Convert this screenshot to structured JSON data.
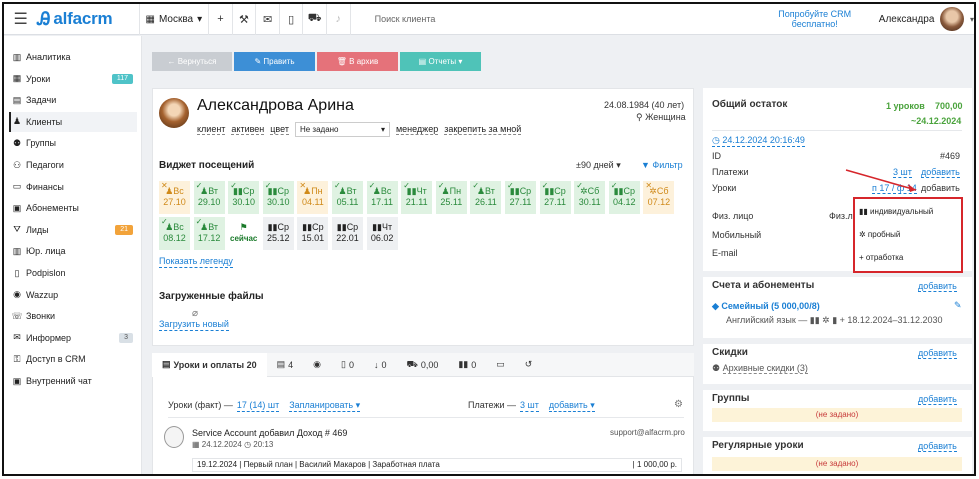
{
  "topbar": {
    "brand": "alfacrm",
    "branch": "Москва",
    "search_placeholder": "Поиск клиента",
    "promo": "Попробуйте CRM бесплатно!",
    "user": "Александра"
  },
  "sidebar": {
    "items": [
      {
        "label": "Аналитика",
        "icon": "chart-icon",
        "badge": ""
      },
      {
        "label": "Уроки",
        "icon": "calendar-icon",
        "badge": "117",
        "badge_color": "#4fc3c8"
      },
      {
        "label": "Задачи",
        "icon": "clipboard-icon",
        "badge": ""
      },
      {
        "label": "Клиенты",
        "icon": "user-icon",
        "badge": "",
        "active": true
      },
      {
        "label": "Группы",
        "icon": "users-icon",
        "badge": ""
      },
      {
        "label": "Педагоги",
        "icon": "teacher-icon",
        "badge": ""
      },
      {
        "label": "Финансы",
        "icon": "money-icon",
        "badge": ""
      },
      {
        "label": "Абонементы",
        "icon": "ticket-icon",
        "badge": ""
      },
      {
        "label": "Лиды",
        "icon": "funnel-icon",
        "badge": "21",
        "badge_color": "#f2a33a"
      },
      {
        "label": "Юр. лица",
        "icon": "building-icon",
        "badge": ""
      },
      {
        "label": "Podpislon",
        "icon": "doc-icon",
        "badge": ""
      },
      {
        "label": "Wazzup",
        "icon": "chat-icon",
        "badge": ""
      },
      {
        "label": "Звонки",
        "icon": "phone-icon",
        "badge": ""
      },
      {
        "label": "Информер",
        "icon": "mail-icon",
        "badge": "3",
        "badge_color": "#d9e0e6"
      },
      {
        "label": "Доступ в CRM",
        "icon": "lock-icon",
        "badge": ""
      },
      {
        "label": "Внутренний чат",
        "icon": "chat-box-icon",
        "badge": ""
      }
    ]
  },
  "actions": [
    {
      "label": "← Вернуться",
      "color": "#c9cdd2",
      "width": 80
    },
    {
      "label": "✎ Править",
      "color": "#3d8fd6",
      "width": 81
    },
    {
      "label": "🗑 В архив",
      "color": "#e5727a",
      "width": 81
    },
    {
      "label": "▤ Отчеты ▾",
      "color": "#4fc3b8",
      "width": 81
    }
  ],
  "client": {
    "name": "Александрова Арина",
    "dob": "24.08.1984 (40 лет)",
    "gender": "Женщина",
    "meta": [
      "клиент",
      "активен",
      "цвет"
    ],
    "status_select": "Не задано",
    "manager": "менеджер",
    "assign": "закрепить за мной"
  },
  "widget": {
    "title": "Виджет посещений",
    "range": "±90 дней ▾",
    "filter": "Фильтр",
    "legend_link": "Показать легенду",
    "days": [
      {
        "d": "Вс",
        "n": "27.10",
        "c": "y"
      },
      {
        "d": "Вт",
        "n": "29.10",
        "c": "g"
      },
      {
        "d": "Ср",
        "n": "30.10",
        "c": "g"
      },
      {
        "d": "Ср",
        "n": "30.10",
        "c": "g"
      },
      {
        "d": "Пн",
        "n": "04.11",
        "c": "y"
      },
      {
        "d": "Вт",
        "n": "05.11",
        "c": "g"
      },
      {
        "d": "Вс",
        "n": "17.11",
        "c": "g"
      },
      {
        "d": "Чт",
        "n": "21.11",
        "c": "g"
      },
      {
        "d": "Пн",
        "n": "25.11",
        "c": "g"
      },
      {
        "d": "Вт",
        "n": "26.11",
        "c": "g"
      },
      {
        "d": "Ср",
        "n": "27.11",
        "c": "g"
      },
      {
        "d": "Ср",
        "n": "27.11",
        "c": "g"
      },
      {
        "d": "Сб",
        "n": "30.11",
        "c": "g"
      },
      {
        "d": "Ср",
        "n": "04.12",
        "c": "g"
      },
      {
        "d": "Сб",
        "n": "07.12",
        "c": "y"
      },
      {
        "d": "Вс",
        "n": "08.12",
        "c": "g"
      },
      {
        "d": "Вт",
        "n": "17.12",
        "c": "g"
      },
      {
        "d": "",
        "n": "сейчас",
        "c": "t"
      },
      {
        "d": "Ср",
        "n": "25.12",
        "c": "n"
      },
      {
        "d": "Ср",
        "n": "15.01",
        "c": "n"
      },
      {
        "d": "Ср",
        "n": "22.01",
        "c": "n"
      },
      {
        "d": "Чт",
        "n": "06.02",
        "c": "n"
      }
    ]
  },
  "files": {
    "title": "Загруженные файлы",
    "upload": "Загрузить новый"
  },
  "tabs": [
    "Уроки и оплаты 20",
    "4",
    "",
    "0",
    "0",
    "0,00",
    "0",
    "",
    ""
  ],
  "lessons": {
    "fact_label": "Уроки (факт) —",
    "fact_value": "17 (14) шт",
    "plan": "Запланировать",
    "payments_label": "Платежи —",
    "payments_value": "3 шт",
    "add": "добавить"
  },
  "feed": {
    "author": "Service Account",
    "action": "добавил Доход # 469",
    "date": "24.12.2024",
    "time": "20:13",
    "email": "support@alfacrm.pro",
    "row": "19.12.2024 | Первый план | Василий Макаров | Заработная плата",
    "amount": "| 1 000,00 р."
  },
  "right": {
    "title": "Общий остаток",
    "lessons_left": "1 уроков",
    "money_left": "700,00",
    "until": "~24.12.2024",
    "timestamp": "24.12.2024 20:16:49",
    "id_label": "ID",
    "id_value": "#469",
    "pay_label": "Платежи",
    "pay_value": "3 шт",
    "add": "добавить",
    "lessons_label": "Уроки",
    "lessons_value": "п 17 / ф 14",
    "fiz_label": "Физ. лицо",
    "fiz_label2": "Физ.л",
    "mobile_label": "Мобильный",
    "email_label": "E-mail",
    "accounts_title": "Счета и абонементы",
    "sub_name": "Семейный (5 000,00/8)",
    "sub_detail": "Английский язык — ▮▮ ✲ ▮ +   18.12.2024–31.12.2030",
    "discounts_title": "Скидки",
    "discounts_archive": "Архивные скидки (3)",
    "groups_title": "Группы",
    "not_set": "(не задано)",
    "regular_title": "Регулярные уроки"
  },
  "popup": {
    "items": [
      "▮▮ индивидуальный",
      "✲ пробный",
      "+ отработка"
    ]
  }
}
